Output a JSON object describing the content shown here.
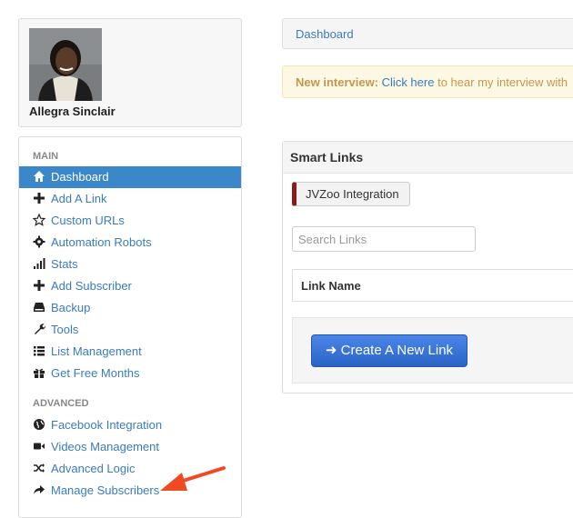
{
  "profile": {
    "name": "Allegra Sinclair"
  },
  "sidebar": {
    "main_header": "MAIN",
    "main_items": [
      {
        "label": "Dashboard",
        "icon": "home-icon",
        "active": true
      },
      {
        "label": "Add A Link",
        "icon": "plus-icon"
      },
      {
        "label": "Custom URLs",
        "icon": "star-icon"
      },
      {
        "label": "Automation Robots",
        "icon": "gear-icon"
      },
      {
        "label": "Stats",
        "icon": "signal-icon"
      },
      {
        "label": "Add Subscriber",
        "icon": "plus-icon"
      },
      {
        "label": "Backup",
        "icon": "hdd-icon"
      },
      {
        "label": "Tools",
        "icon": "wrench-icon"
      },
      {
        "label": "List Management",
        "icon": "list-icon"
      },
      {
        "label": "Get Free Months",
        "icon": "gift-icon"
      }
    ],
    "advanced_header": "ADVANCED",
    "advanced_items": [
      {
        "label": "Facebook Integration",
        "icon": "globe-icon"
      },
      {
        "label": "Videos Management",
        "icon": "video-icon"
      },
      {
        "label": "Advanced Logic",
        "icon": "shuffle-icon"
      },
      {
        "label": "Manage Subscribers",
        "icon": "share-icon"
      }
    ]
  },
  "breadcrumb": {
    "label": "Dashboard"
  },
  "alert": {
    "strong": "New interview:",
    "link": "Click here",
    "text": "to hear my interview with"
  },
  "smart_links": {
    "title": "Smart Links",
    "jvzoo_button": "JVZoo Integration",
    "search_placeholder": "Search Links",
    "table_header": "Link Name",
    "create_button": "➜ Create A New Link"
  },
  "colors": {
    "accent": "#3a87c9",
    "link": "#3a7bbf",
    "arrow": "#f04a24",
    "button": "#2a63c6"
  }
}
